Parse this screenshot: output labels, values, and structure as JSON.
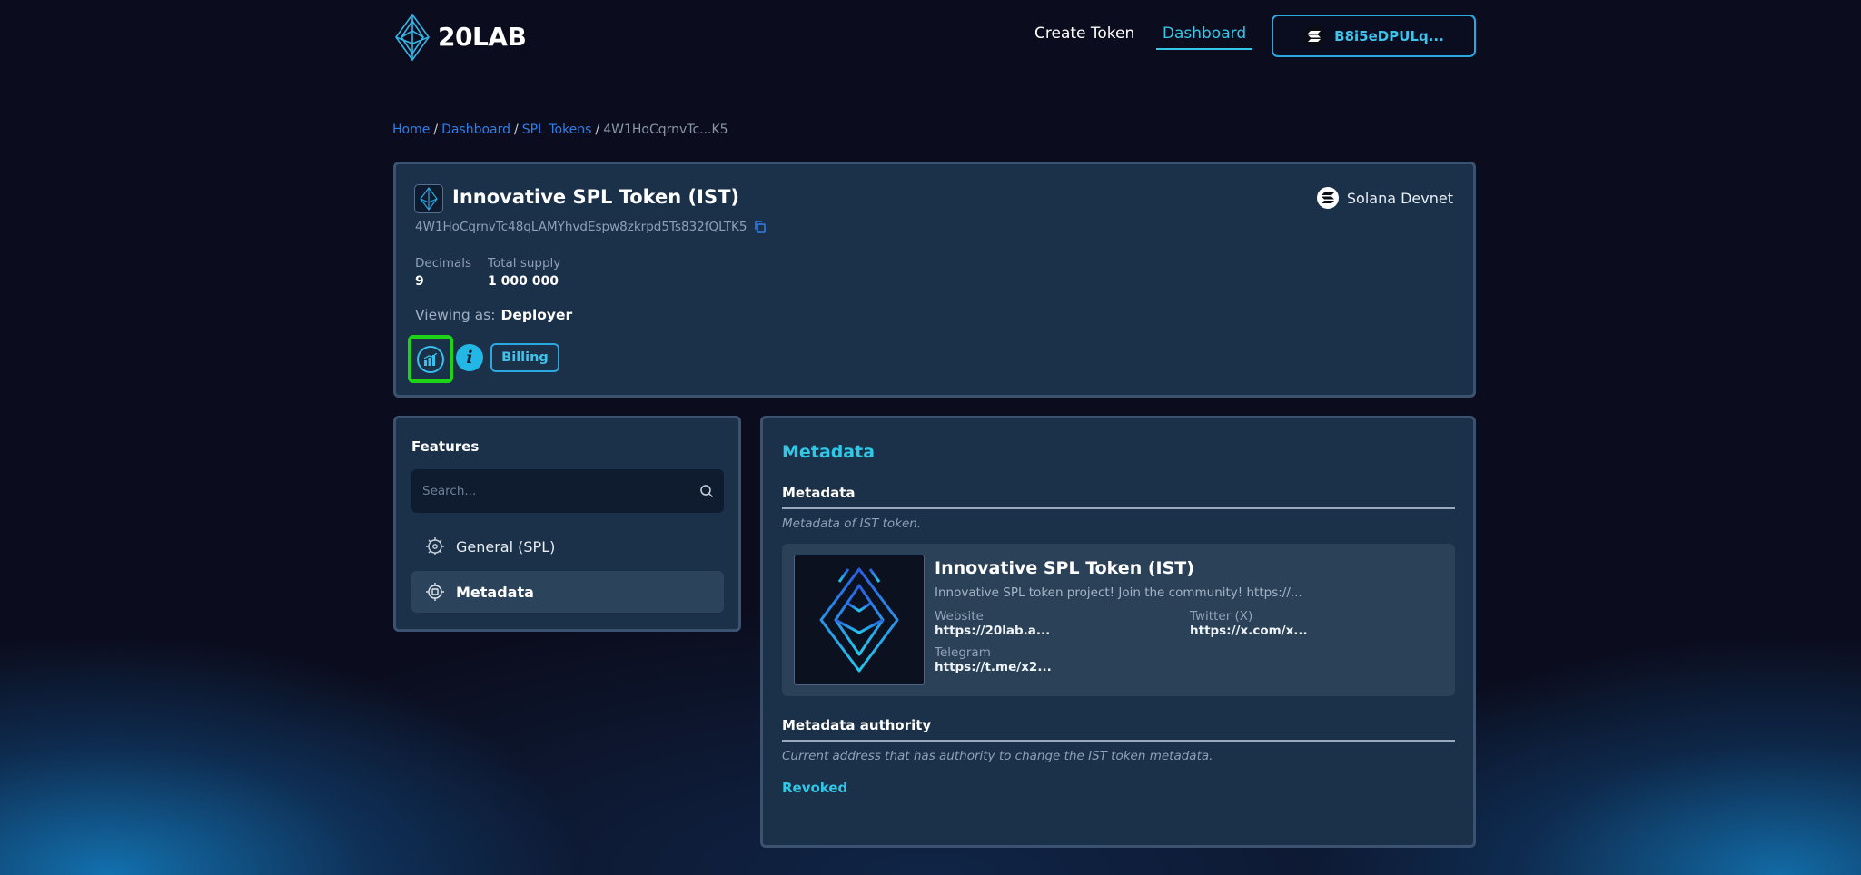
{
  "header": {
    "logo_text": "20LAB",
    "nav": [
      {
        "label": "Create Token"
      },
      {
        "label": "Dashboard",
        "active": true
      }
    ],
    "wallet_label": "B8i5eDPULq..."
  },
  "breadcrumb": {
    "home": "Home",
    "dashboard": "Dashboard",
    "spl_tokens": "SPL Tokens",
    "current": "4W1HoCqrnvTc...K5"
  },
  "token": {
    "name": "Innovative SPL Token (IST)",
    "address": "4W1HoCqrnvTc48qLAMYhvdEspw8zkrpd5Ts832fQLTK5",
    "network": "Solana Devnet",
    "stats": {
      "decimals_label": "Decimals",
      "decimals_value": "9",
      "supply_label": "Total supply",
      "supply_value": "1 000 000"
    },
    "viewing_label": "Viewing as:",
    "viewing_role": "Deployer",
    "billing_label": "Billing"
  },
  "features": {
    "title": "Features",
    "search_placeholder": "Search...",
    "items": [
      {
        "label": "General (SPL)",
        "icon": "gear-code-icon"
      },
      {
        "label": "Metadata",
        "icon": "gear-puzzle-icon",
        "active": true
      }
    ]
  },
  "metadata": {
    "heading": "Metadata",
    "section1": {
      "title": "Metadata",
      "description": "Metadata of IST token."
    },
    "card": {
      "name": "Innovative SPL Token (IST)",
      "description": "Innovative SPL token project! Join the community! https://...",
      "website_label": "Website",
      "website_value": "https://20lab.a...",
      "twitter_label": "Twitter (X)",
      "twitter_value": "https://x.com/x...",
      "telegram_label": "Telegram",
      "telegram_value": "https://t.me/x2..."
    },
    "section2": {
      "title": "Metadata authority",
      "description": "Current address that has authority to change the IST token metadata.",
      "status": "Revoked"
    }
  },
  "colors": {
    "accent": "#2ec8e8",
    "link": "#2f7fe8",
    "highlight": "#1ed418",
    "panel": "#1b3149"
  }
}
